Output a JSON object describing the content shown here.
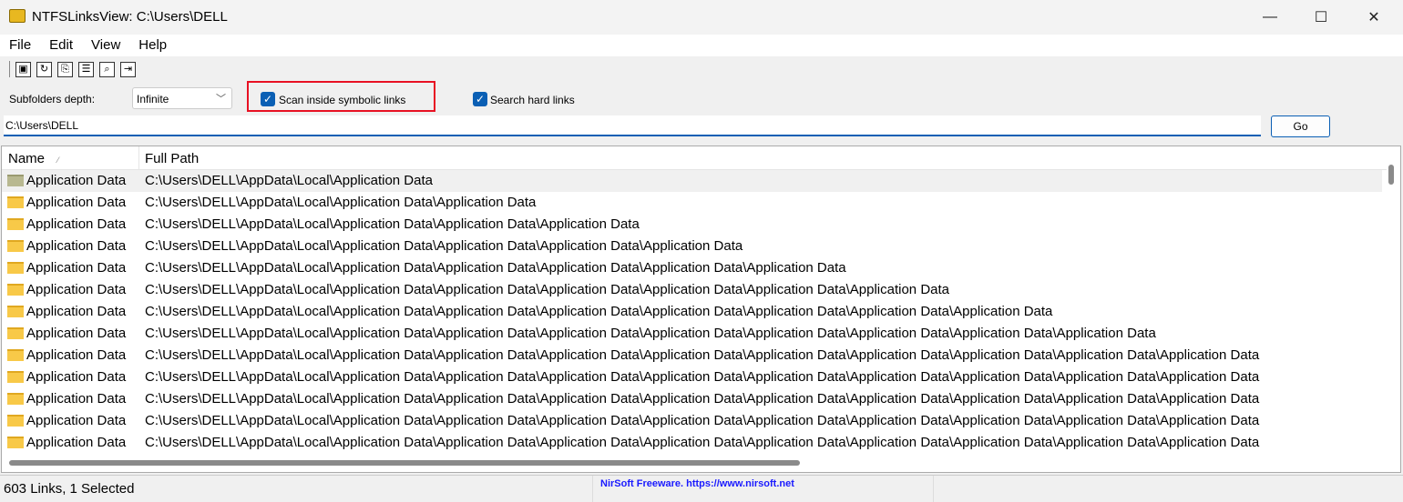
{
  "window": {
    "title": "NTFSLinksView:  C:\\Users\\DELL",
    "minimize": "—",
    "maximize": "☐",
    "close": "✕"
  },
  "menu": [
    "File",
    "Edit",
    "View",
    "Help"
  ],
  "toolbar": [
    {
      "icon": "save-icon",
      "glyph": "▣"
    },
    {
      "icon": "refresh-icon",
      "glyph": "↻"
    },
    {
      "icon": "copy-icon",
      "glyph": "⎘"
    },
    {
      "icon": "properties-icon",
      "glyph": "☰"
    },
    {
      "icon": "find-icon",
      "glyph": "⌕"
    },
    {
      "icon": "exit-icon",
      "glyph": "⇥"
    }
  ],
  "options": {
    "depth_label": "Subfolders depth:",
    "depth_value": "Infinite",
    "scan_symlinks_label": "Scan inside symbolic links",
    "scan_symlinks_checked": true,
    "hard_links_label": "Search hard links",
    "hard_links_checked": true,
    "highlight_color": "#e81123"
  },
  "path": {
    "value": "C:\\Users\\DELL",
    "go_label": "Go"
  },
  "list": {
    "columns": [
      "Name",
      "Full Path"
    ],
    "sort_indicator": "⁄",
    "rows": [
      {
        "name": "Application Data",
        "path": "C:\\Users\\DELL\\AppData\\Local\\Application Data",
        "selected": true
      },
      {
        "name": "Application Data",
        "path": "C:\\Users\\DELL\\AppData\\Local\\Application Data\\Application Data"
      },
      {
        "name": "Application Data",
        "path": "C:\\Users\\DELL\\AppData\\Local\\Application Data\\Application Data\\Application Data"
      },
      {
        "name": "Application Data",
        "path": "C:\\Users\\DELL\\AppData\\Local\\Application Data\\Application Data\\Application Data\\Application Data"
      },
      {
        "name": "Application Data",
        "path": "C:\\Users\\DELL\\AppData\\Local\\Application Data\\Application Data\\Application Data\\Application Data\\Application Data"
      },
      {
        "name": "Application Data",
        "path": "C:\\Users\\DELL\\AppData\\Local\\Application Data\\Application Data\\Application Data\\Application Data\\Application Data\\Application Data"
      },
      {
        "name": "Application Data",
        "path": "C:\\Users\\DELL\\AppData\\Local\\Application Data\\Application Data\\Application Data\\Application Data\\Application Data\\Application Data\\Application Data"
      },
      {
        "name": "Application Data",
        "path": "C:\\Users\\DELL\\AppData\\Local\\Application Data\\Application Data\\Application Data\\Application Data\\Application Data\\Application Data\\Application Data\\Application Data"
      },
      {
        "name": "Application Data",
        "path": "C:\\Users\\DELL\\AppData\\Local\\Application Data\\Application Data\\Application Data\\Application Data\\Application Data\\Application Data\\Application Data\\Application Data\\Application Data"
      },
      {
        "name": "Application Data",
        "path": "C:\\Users\\DELL\\AppData\\Local\\Application Data\\Application Data\\Application Data\\Application Data\\Application Data\\Application Data\\Application Data\\Application Data\\Application Data"
      },
      {
        "name": "Application Data",
        "path": "C:\\Users\\DELL\\AppData\\Local\\Application Data\\Application Data\\Application Data\\Application Data\\Application Data\\Application Data\\Application Data\\Application Data\\Application Data"
      },
      {
        "name": "Application Data",
        "path": "C:\\Users\\DELL\\AppData\\Local\\Application Data\\Application Data\\Application Data\\Application Data\\Application Data\\Application Data\\Application Data\\Application Data\\Application Data"
      },
      {
        "name": "Application Data",
        "path": "C:\\Users\\DELL\\AppData\\Local\\Application Data\\Application Data\\Application Data\\Application Data\\Application Data\\Application Data\\Application Data\\Application Data\\Application Data"
      }
    ]
  },
  "status": {
    "count": "603 Links, 1 Selected",
    "credit": "NirSoft Freeware. https://www.nirsoft.net"
  }
}
